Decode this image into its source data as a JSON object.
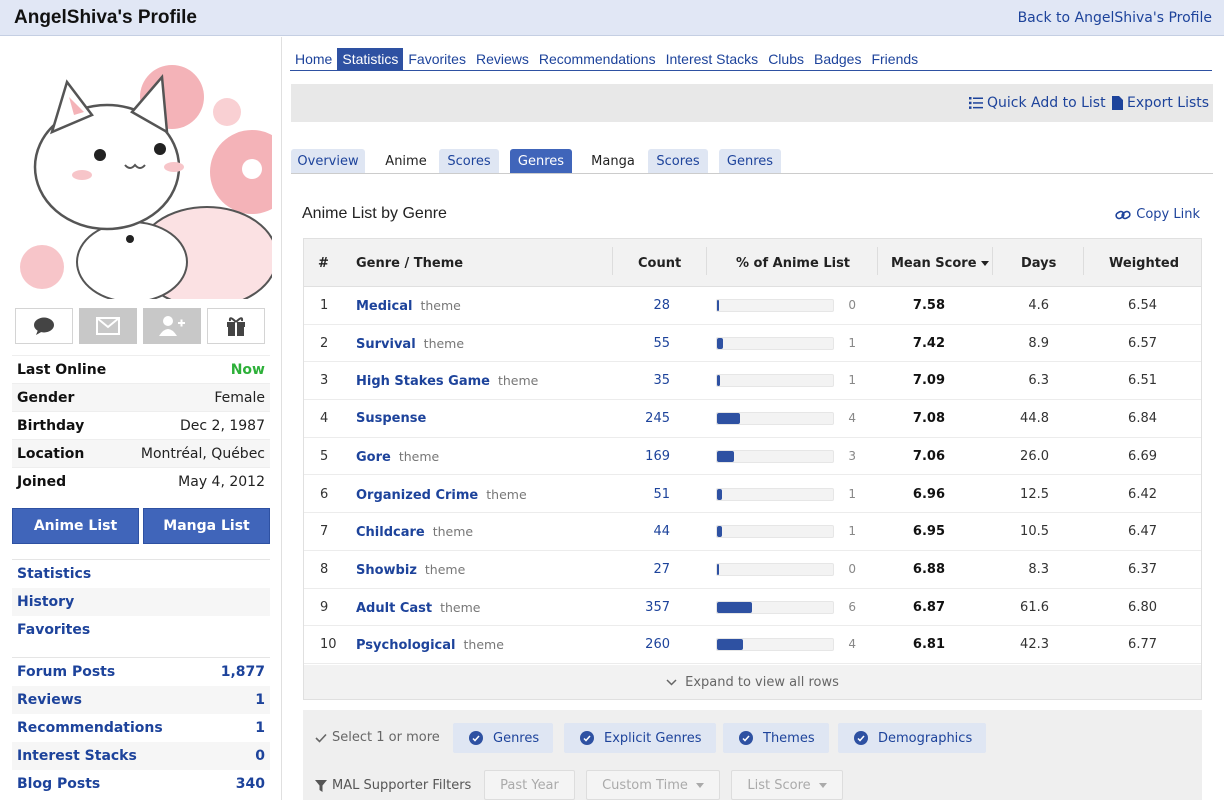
{
  "header": {
    "title": "AngelShiva's Profile",
    "back_link": "Back to AngelShiva's Profile"
  },
  "profile": {
    "info": [
      {
        "label": "Last Online",
        "value": "Now"
      },
      {
        "label": "Gender",
        "value": "Female"
      },
      {
        "label": "Birthday",
        "value": "Dec 2, 1987"
      },
      {
        "label": "Location",
        "value": "Montréal, Québec"
      },
      {
        "label": "Joined",
        "value": "May 4, 2012"
      }
    ],
    "anime_list_button": "Anime List",
    "manga_list_button": "Manga List",
    "links": [
      "Statistics",
      "History",
      "Favorites"
    ],
    "stats": [
      {
        "label": "Forum Posts",
        "value": "1,877"
      },
      {
        "label": "Reviews",
        "value": "1"
      },
      {
        "label": "Recommendations",
        "value": "1"
      },
      {
        "label": "Interest Stacks",
        "value": "0"
      },
      {
        "label": "Blog Posts",
        "value": "340"
      }
    ],
    "action_icons": [
      "comment-icon",
      "mail-icon",
      "add-friend-icon",
      "gift-icon"
    ]
  },
  "nav": {
    "tabs": [
      "Home",
      "Statistics",
      "Favorites",
      "Reviews",
      "Recommendations",
      "Interest Stacks",
      "Clubs",
      "Badges",
      "Friends"
    ],
    "active": "Statistics"
  },
  "toolbar": {
    "quick_add": "Quick Add to List",
    "export": "Export Lists"
  },
  "subtabs": {
    "overview": "Overview",
    "anime_label": "Anime",
    "anime_scores": "Scores",
    "anime_genres": "Genres",
    "manga_label": "Manga",
    "manga_scores": "Scores",
    "manga_genres": "Genres"
  },
  "section": {
    "title": "Anime List by Genre",
    "copy_link": "Copy Link"
  },
  "table": {
    "headers": {
      "num": "#",
      "genre": "Genre / Theme",
      "count": "Count",
      "percent": "% of Anime List",
      "mean": "Mean Score",
      "days": "Days",
      "weighted": "Weighted"
    },
    "rows": [
      {
        "num": "1",
        "genre": "Medical",
        "tag": "theme",
        "count": "28",
        "pct": "0",
        "pct_value": 0.4,
        "mean": "7.58",
        "days": "4.6",
        "weighted": "6.54"
      },
      {
        "num": "2",
        "genre": "Survival",
        "tag": "theme",
        "count": "55",
        "pct": "1",
        "pct_value": 1,
        "mean": "7.42",
        "days": "8.9",
        "weighted": "6.57"
      },
      {
        "num": "3",
        "genre": "High Stakes Game",
        "tag": "theme",
        "count": "35",
        "pct": "1",
        "pct_value": 0.6,
        "mean": "7.09",
        "days": "6.3",
        "weighted": "6.51"
      },
      {
        "num": "4",
        "genre": "Suspense",
        "tag": "",
        "count": "245",
        "pct": "4",
        "pct_value": 4,
        "mean": "7.08",
        "days": "44.8",
        "weighted": "6.84"
      },
      {
        "num": "5",
        "genre": "Gore",
        "tag": "theme",
        "count": "169",
        "pct": "3",
        "pct_value": 3,
        "mean": "7.06",
        "days": "26.0",
        "weighted": "6.69"
      },
      {
        "num": "6",
        "genre": "Organized Crime",
        "tag": "theme",
        "count": "51",
        "pct": "1",
        "pct_value": 0.9,
        "mean": "6.96",
        "days": "12.5",
        "weighted": "6.42"
      },
      {
        "num": "7",
        "genre": "Childcare",
        "tag": "theme",
        "count": "44",
        "pct": "1",
        "pct_value": 0.8,
        "mean": "6.95",
        "days": "10.5",
        "weighted": "6.47"
      },
      {
        "num": "8",
        "genre": "Showbiz",
        "tag": "theme",
        "count": "27",
        "pct": "0",
        "pct_value": 0.4,
        "mean": "6.88",
        "days": "8.3",
        "weighted": "6.37"
      },
      {
        "num": "9",
        "genre": "Adult Cast",
        "tag": "theme",
        "count": "357",
        "pct": "6",
        "pct_value": 6,
        "mean": "6.87",
        "days": "61.6",
        "weighted": "6.80"
      },
      {
        "num": "10",
        "genre": "Psychological",
        "tag": "theme",
        "count": "260",
        "pct": "4",
        "pct_value": 4.5,
        "mean": "6.81",
        "days": "42.3",
        "weighted": "6.77"
      }
    ],
    "expand_label": "Expand to view all rows"
  },
  "filters": {
    "select_label": "Select 1 or more",
    "chips": [
      "Genres",
      "Explicit Genres",
      "Themes",
      "Demographics"
    ],
    "supporter_label": "MAL Supporter Filters",
    "dropdowns": [
      "Past Year",
      "Custom Time",
      "List Score"
    ]
  },
  "colors": {
    "brand": "#2e51a2",
    "link": "#1d439b",
    "online": "#2db039"
  }
}
